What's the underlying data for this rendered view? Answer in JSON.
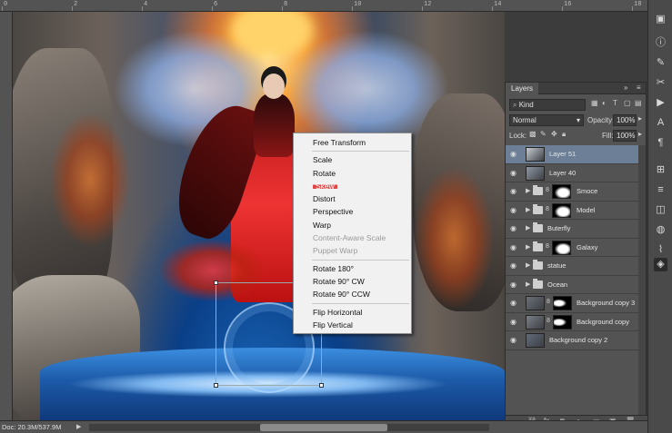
{
  "ruler": {
    "ticks": [
      "0",
      "2",
      "4",
      "6",
      "8",
      "10",
      "12",
      "14",
      "16",
      "18"
    ]
  },
  "context_menu": {
    "groups": [
      [
        "Free Transform"
      ],
      [
        "Scale",
        "Rotate",
        "Skew",
        "Distort",
        "Perspective",
        "Warp",
        "Content-Aware Scale",
        "Puppet Warp"
      ],
      [
        "Rotate 180°",
        "Rotate 90° CW",
        "Rotate 90° CCW"
      ],
      [
        "Flip Horizontal",
        "Flip Vertical"
      ]
    ],
    "highlighted": "Skew",
    "disabled": [
      "Content-Aware Scale",
      "Puppet Warp"
    ]
  },
  "layers_panel": {
    "tab": "Layers",
    "filter_placeholder": "Kind",
    "blend_mode": "Normal",
    "opacity_label": "Opacity:",
    "opacity_value": "100%",
    "lock_label": "Lock:",
    "fill_label": "Fill:",
    "fill_value": "100%",
    "layers": [
      {
        "name": "Layer 51",
        "kind": "pixel",
        "selected": true
      },
      {
        "name": "Layer 40",
        "kind": "pixel"
      },
      {
        "name": "Smoce",
        "kind": "group-mask"
      },
      {
        "name": "Model",
        "kind": "group-mask"
      },
      {
        "name": "Buterfly",
        "kind": "group"
      },
      {
        "name": "Galaxy",
        "kind": "group-mask"
      },
      {
        "name": "statue",
        "kind": "group"
      },
      {
        "name": "Ocean",
        "kind": "group"
      },
      {
        "name": "Background copy 3",
        "kind": "pixel-mask"
      },
      {
        "name": "Background copy",
        "kind": "pixel-mask"
      },
      {
        "name": "Background copy 2",
        "kind": "pixel"
      }
    ]
  },
  "status_bar": {
    "doc_info": "Doc: 20.3M/537.9M"
  },
  "colors": {
    "selected_layer": "#6c7f97",
    "menu_highlight": "#e24545",
    "panel_bg": "#535353"
  }
}
